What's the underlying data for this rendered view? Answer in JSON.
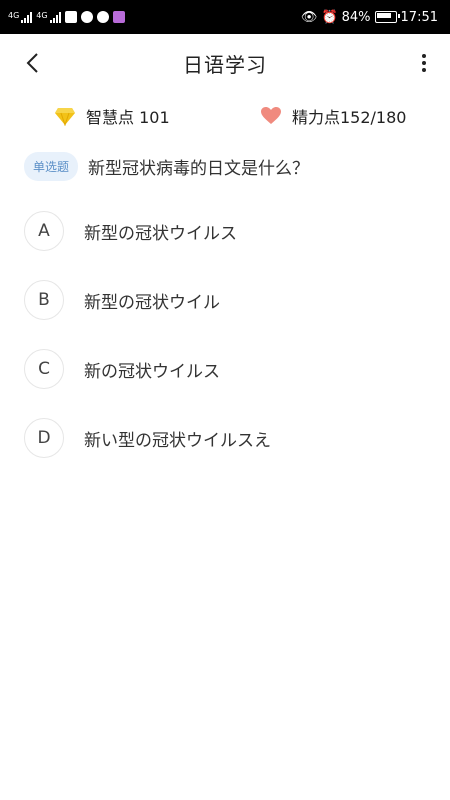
{
  "status_bar": {
    "net1": "4G",
    "net2": "4G",
    "battery": "84%",
    "time": "17:51"
  },
  "header": {
    "title": "日语学习"
  },
  "stats": {
    "wisdom_label": "智慧点 101",
    "energy_label": "精力点152/180"
  },
  "question": {
    "type_label": "单选题",
    "text": "新型冠状病毒的日文是什么？"
  },
  "options": [
    {
      "letter": "A",
      "text": "新型の冠状ウイルス"
    },
    {
      "letter": "B",
      "text": "新型の冠状ウイル"
    },
    {
      "letter": "C",
      "text": "新の冠状ウイルス"
    },
    {
      "letter": "D",
      "text": "新い型の冠状ウイルスえ"
    }
  ],
  "colors": {
    "badge_bg": "#e8f1fb",
    "badge_text": "#5b8fc7",
    "gem": "#f2c218",
    "heart": "#f08a7e"
  }
}
